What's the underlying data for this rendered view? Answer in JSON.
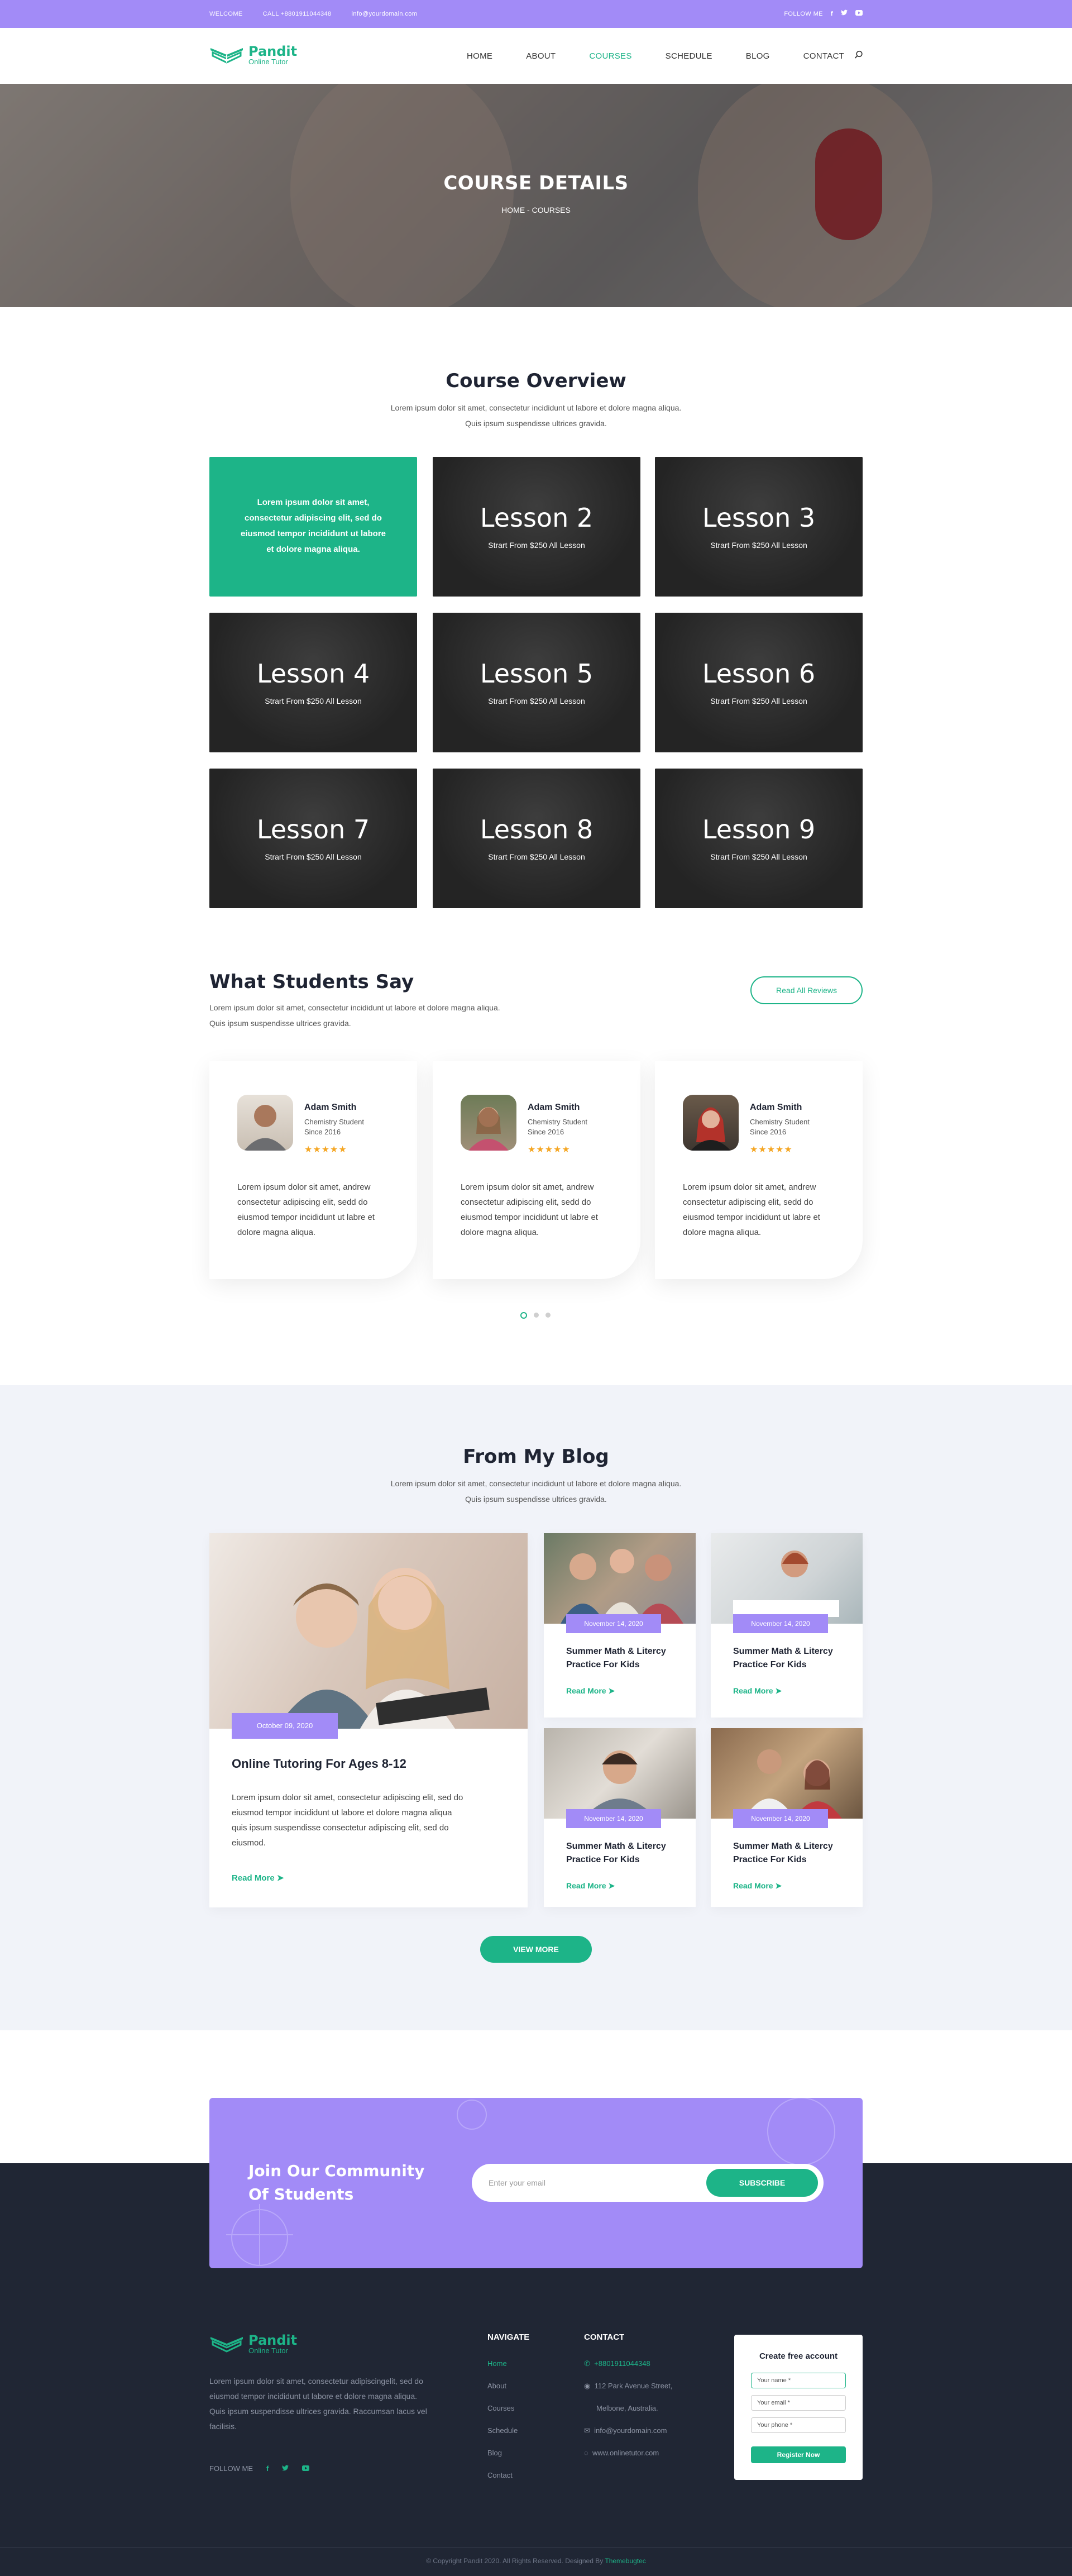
{
  "topbar": {
    "welcome": "WELCOME",
    "phone": "CALL +8801911044348",
    "email": "info@yourdomain.com",
    "follow": "FOLLOW ME"
  },
  "brand": {
    "name": "Pandit",
    "tagline": "Online Tutor"
  },
  "nav": {
    "items": [
      {
        "label": "HOME"
      },
      {
        "label": "ABOUT"
      },
      {
        "label": "COURSES",
        "active": true
      },
      {
        "label": "SCHEDULE"
      },
      {
        "label": "BLOG"
      },
      {
        "label": "CONTACT"
      }
    ]
  },
  "hero": {
    "title": "COURSE DETAILS",
    "breadcrumb": "HOME - COURSES"
  },
  "overview": {
    "title": "Course Overview",
    "subtitle": "Lorem ipsum dolor sit amet, consectetur incididunt ut labore et dolore magna aliqua. Quis ipsum suspendisse ultrices gravida.",
    "intro": "Lorem ipsum dolor sit amet, consectetur adipiscing elit, sed do eiusmod tempor incididunt ut labore et dolore magna aliqua.",
    "lessons": [
      {
        "title": "Lesson 2",
        "price": "Strart From $250 All Lesson"
      },
      {
        "title": "Lesson 3",
        "price": "Strart From $250 All Lesson"
      },
      {
        "title": "Lesson 4",
        "price": "Strart From $250 All Lesson"
      },
      {
        "title": "Lesson 5",
        "price": "Strart From $250 All Lesson"
      },
      {
        "title": "Lesson 6",
        "price": "Strart From $250 All Lesson"
      },
      {
        "title": "Lesson 7",
        "price": "Strart From $250 All Lesson"
      },
      {
        "title": "Lesson 8",
        "price": "Strart From $250 All Lesson"
      },
      {
        "title": "Lesson 9",
        "price": "Strart From $250 All Lesson"
      }
    ]
  },
  "testimonials": {
    "title": "What Students Say",
    "subtitle": "Lorem ipsum dolor sit amet, consectetur incididunt ut labore et dolore magna aliqua. Quis ipsum suspendisse ultrices gravida.",
    "button": "Read All Reviews",
    "items": [
      {
        "name": "Adam Smith",
        "role": "Chemistry Student",
        "since": "Since 2016",
        "stars": "★★★★★",
        "quote": "Lorem ipsum dolor sit amet, andrew consectetur adipiscing elit, sedd do eiusmod tempor incididunt ut labre et dolore magna aliqua."
      },
      {
        "name": "Adam Smith",
        "role": "Chemistry Student",
        "since": "Since 2016",
        "stars": "★★★★★",
        "quote": "Lorem ipsum dolor sit amet, andrew consectetur adipiscing elit, sedd do eiusmod tempor incididunt ut labre et dolore magna aliqua."
      },
      {
        "name": "Adam Smith",
        "role": "Chemistry Student",
        "since": "Since 2016",
        "stars": "★★★★★",
        "quote": "Lorem ipsum dolor sit amet, andrew consectetur adipiscing elit, sedd do eiusmod tempor incididunt ut labre et dolore magna aliqua."
      }
    ]
  },
  "blog": {
    "title": "From My Blog",
    "subtitle": "Lorem ipsum dolor sit amet, consectetur incididunt ut labore et dolore magna aliqua. Quis ipsum suspendisse ultrices gravida.",
    "featured": {
      "date": "October 09, 2020",
      "title": "Online Tutoring For Ages 8-12",
      "excerpt": "Lorem ipsum dolor sit amet, consectetur adipiscing elit, sed do eiusmod tempor incididunt ut labore et dolore magna aliqua quis ipsum suspendisse consectetur adipiscing elit, sed do eiusmod.",
      "more": "Read More"
    },
    "posts": [
      {
        "date": "November 14, 2020",
        "title": "Summer Math & Litercy Practice For Kids",
        "more": "Read More"
      },
      {
        "date": "November 14, 2020",
        "title": "Summer Math & Litercy Practice For Kids",
        "more": "Read More"
      },
      {
        "date": "November 14, 2020",
        "title": "Summer Math & Litercy Practice For Kids",
        "more": "Read More"
      },
      {
        "date": "November 14, 2020",
        "title": "Summer Math & Litercy Practice For Kids",
        "more": "Read More"
      }
    ],
    "view_more": "VIEW MORE"
  },
  "cta": {
    "title_line1": "Join Our Community",
    "title_line2": "Of Students",
    "placeholder": "Enter your email",
    "button": "SUBSCRIBE"
  },
  "footer": {
    "about": "Lorem ipsum dolor sit amet, consectetur adipiscingelit, sed do eiusmod tempor incididunt ut labore et dolore magna aliqua. Quis ipsum suspendisse ultrices gravida. Raccumsan lacus vel facilisis.",
    "follow": "FOLLOW ME",
    "navigate_title": "NAVIGATE",
    "navigate": [
      "Home",
      "About",
      "Courses",
      "Schedule",
      "Blog",
      "Contact"
    ],
    "contact_title": "CONTACT",
    "phone": "+8801911044348",
    "address1": "112 Park Avenue Street,",
    "address2": "Melbone, Australia.",
    "email": "info@yourdomain.com",
    "web": "www.onlinetutor.com",
    "form": {
      "title": "Create free account",
      "name": "Your name *",
      "email": "Your email *",
      "phone": "Your phone *",
      "button": "Register Now"
    },
    "copyright": "© Copyright Pandit 2020. All Rights Reserved. Designed By",
    "designer": "Themebugtec"
  },
  "colors": {
    "purple": "#a28bf7",
    "green": "#1db488",
    "dark": "#202634"
  }
}
